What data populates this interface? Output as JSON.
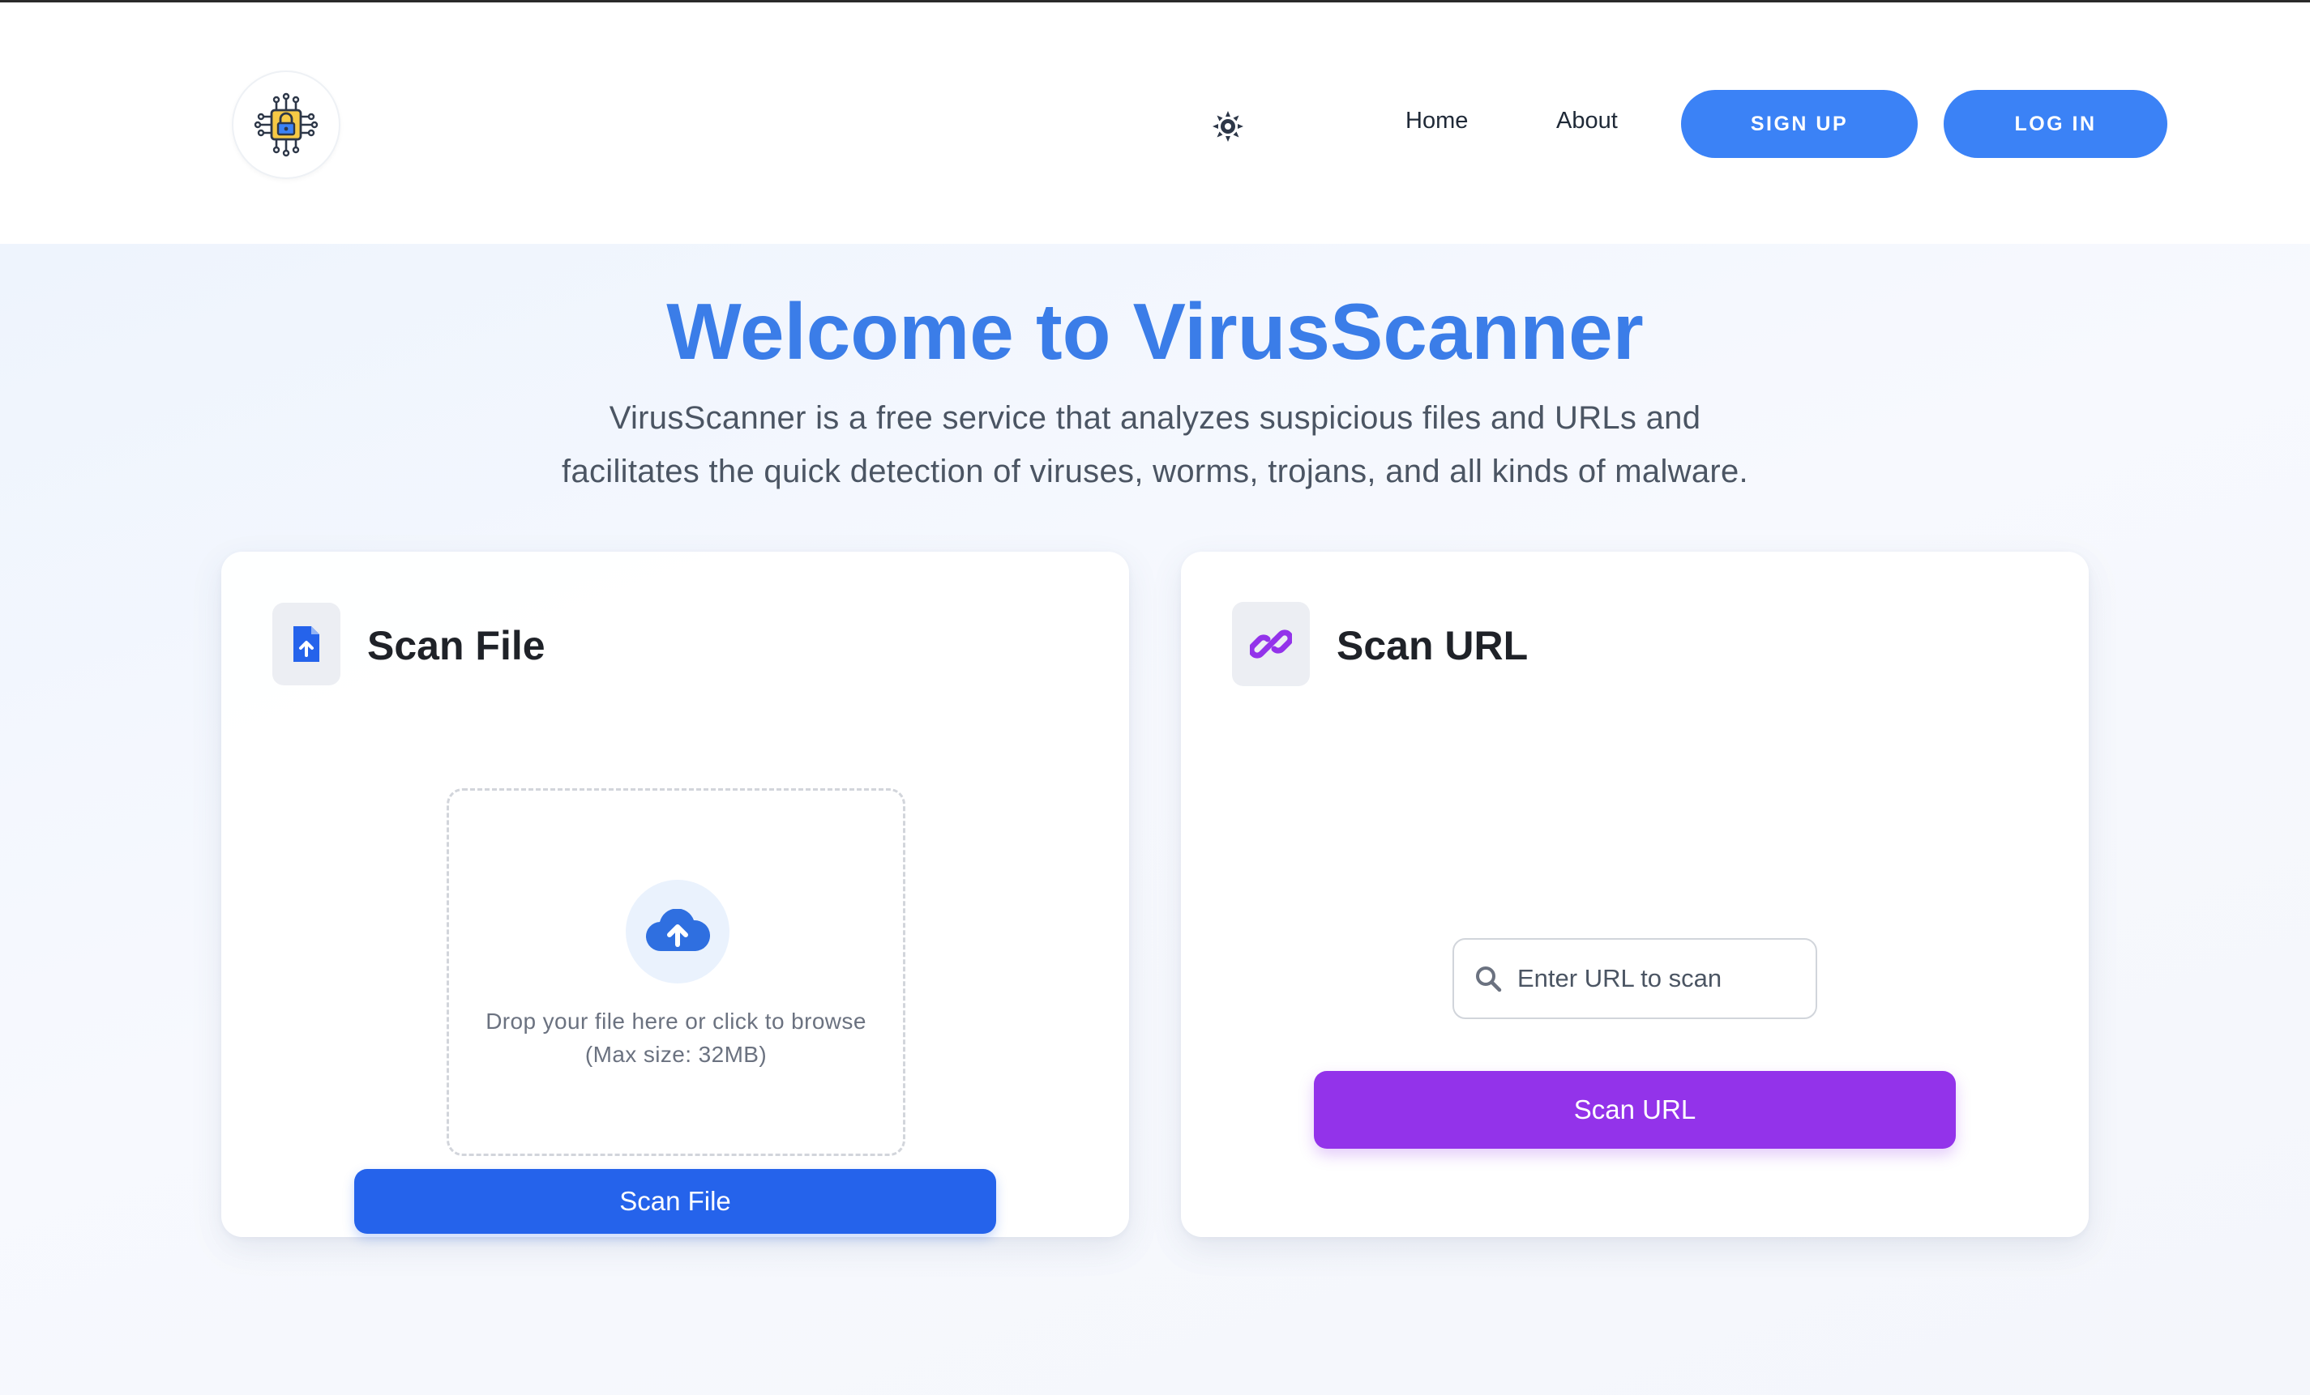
{
  "nav": {
    "logo_icon": "circuit-lock-icon",
    "theme_icon": "sun-icon",
    "links": [
      "Home",
      "About"
    ],
    "signup_label": "SIGN UP",
    "login_label": "LOG IN",
    "accent": "#3b82f6"
  },
  "hero": {
    "title": "Welcome to VirusScanner",
    "desc_line1": "VirusScanner is a free service that analyzes suspicious files and URLs and",
    "desc_line2": "facilitates the quick detection of viruses, worms, trojans, and all kinds of malware."
  },
  "scan_file": {
    "title": "Scan File",
    "icon": "file-upload-icon",
    "drop_line1": "Drop your file here or click to browse",
    "drop_line2": "(Max size: 32MB)",
    "button_label": "Scan File",
    "button_color": "#2563eb"
  },
  "scan_url": {
    "title": "Scan URL",
    "icon": "link-icon",
    "input_placeholder": "Enter URL to scan",
    "button_label": "Scan URL",
    "button_color": "#9333ea"
  }
}
